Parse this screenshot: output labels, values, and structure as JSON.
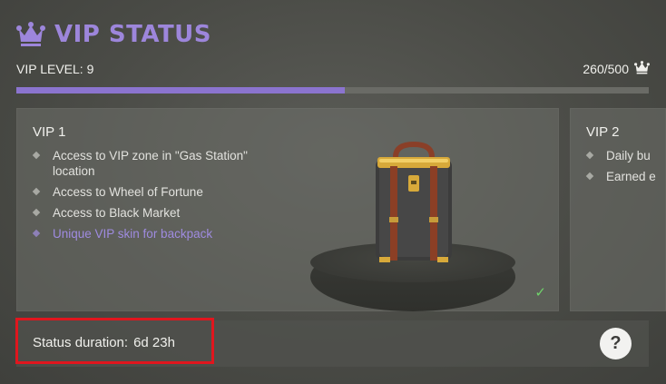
{
  "header": {
    "title": "VIP STATUS",
    "icon": "crown-icon",
    "accent_color": "#9d86db"
  },
  "level": {
    "label": "VIP LEVEL: 9",
    "points": "260/500",
    "points_icon": "crown-icon",
    "progress_fraction": 0.52
  },
  "cards": [
    {
      "title": "VIP 1",
      "perks": [
        "Access to VIP zone in \"Gas Station\" location",
        "Access to Wheel of Fortune",
        "Access to Black Market",
        "Unique VIP skin for backpack"
      ],
      "image": "backpack-icon",
      "check_icon": "checkmark-icon"
    },
    {
      "title": "VIP 2",
      "perks": [
        "Daily bu",
        "Earned e"
      ]
    }
  ],
  "status": {
    "label": "Status duration:",
    "value": "6d 23h"
  },
  "help": {
    "label": "?"
  }
}
